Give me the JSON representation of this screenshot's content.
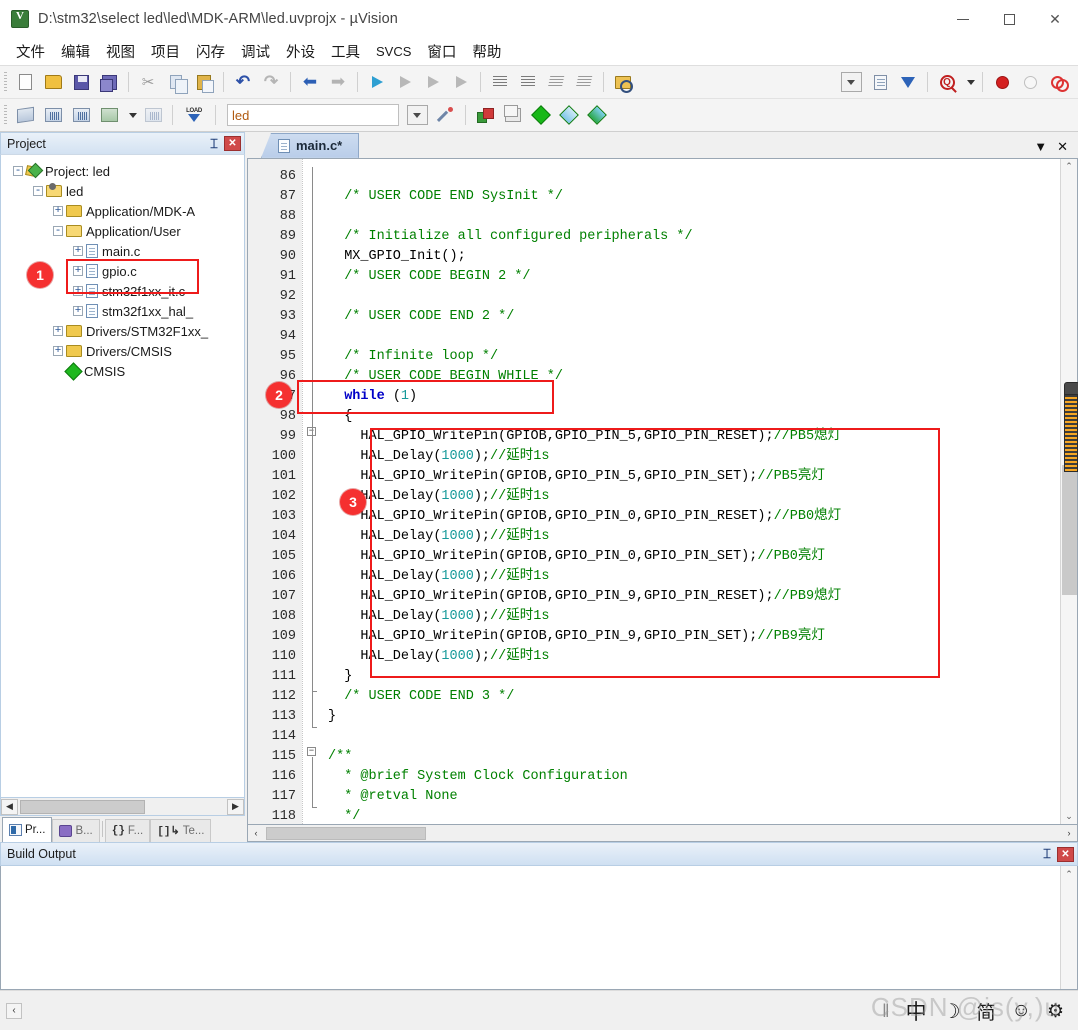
{
  "window": {
    "title": "D:\\stm32\\select led\\led\\MDK-ARM\\led.uvprojx - µVision",
    "app_icon": "uvision-icon",
    "minimize_label": "—",
    "maximize_label": "□",
    "close_label": "✕"
  },
  "menubar": {
    "items": [
      {
        "label": "文件",
        "name": "menu-file"
      },
      {
        "label": "编辑",
        "name": "menu-edit"
      },
      {
        "label": "视图",
        "name": "menu-view"
      },
      {
        "label": "项目",
        "name": "menu-project"
      },
      {
        "label": "闪存",
        "name": "menu-flash"
      },
      {
        "label": "调试",
        "name": "menu-debug"
      },
      {
        "label": "外设",
        "name": "menu-peripherals"
      },
      {
        "label": "工具",
        "name": "menu-tools"
      },
      {
        "label": "SVCS",
        "name": "menu-svcs"
      },
      {
        "label": "窗口",
        "name": "menu-window"
      },
      {
        "label": "帮助",
        "name": "menu-help"
      }
    ]
  },
  "toolbar_main": {
    "buttons": [
      "new-file-icon",
      "open-file-icon",
      "save-icon",
      "save-all-icon",
      "cut-icon",
      "copy-icon",
      "paste-icon",
      "undo-icon",
      "redo-icon",
      "navigate-back-icon",
      "navigate-forward-icon",
      "bookmark-toggle-icon",
      "bookmark-prev-icon",
      "bookmark-next-icon",
      "bookmark-clear-icon",
      "indent-icon",
      "outdent-icon",
      "comment-icon",
      "uncomment-icon",
      "open-folder-browse-icon",
      "dropdown-icon",
      "configuration-wizard-icon",
      "debug-start-icon",
      "find-in-files-icon",
      "find-caret-icon",
      "insert-breakpoint-icon",
      "disable-breakpoint-icon",
      "kill-all-breakpoints-icon"
    ]
  },
  "toolbar_build": {
    "target_value": "led",
    "buttons": [
      "translate-icon",
      "build-icon",
      "rebuild-icon",
      "batch-build-icon",
      "stop-build-icon",
      "download-load-icon",
      "target-dropdown-icon",
      "options-wizard-icon",
      "manage-project-items-icon",
      "multi-project-icon",
      "pack-installer-icon",
      "run-target-icon",
      "manage-runtime-env-icon"
    ]
  },
  "project_panel": {
    "caption": "Project",
    "pin_label": "⌶",
    "close_label": "✕",
    "tree": [
      {
        "label": "Project: led",
        "indent": 0,
        "expander": "-",
        "icon": "project-icon"
      },
      {
        "label": "led",
        "indent": 1,
        "expander": "-",
        "icon": "target-folder-icon"
      },
      {
        "label": "Application/MDK-A",
        "indent": 2,
        "expander": "+",
        "icon": "group-folder-icon"
      },
      {
        "label": "Application/User",
        "indent": 2,
        "expander": "-",
        "icon": "group-folder-icon"
      },
      {
        "label": "main.c",
        "indent": 3,
        "expander": "+",
        "icon": "c-file-icon"
      },
      {
        "label": "gpio.c",
        "indent": 3,
        "expander": "+",
        "icon": "c-file-icon"
      },
      {
        "label": "stm32f1xx_it.c",
        "indent": 3,
        "expander": "+",
        "icon": "c-file-icon"
      },
      {
        "label": "stm32f1xx_hal_",
        "indent": 3,
        "expander": "+",
        "icon": "c-file-icon"
      },
      {
        "label": "Drivers/STM32F1xx_",
        "indent": 2,
        "expander": "+",
        "icon": "group-folder-icon"
      },
      {
        "label": "Drivers/CMSIS",
        "indent": 2,
        "expander": "+",
        "icon": "group-folder-icon"
      },
      {
        "label": "CMSIS",
        "indent": 2,
        "expander": "",
        "icon": "cmsis-icon"
      }
    ],
    "hscroll_left": "◀",
    "hscroll_right": "▶",
    "tabs": [
      {
        "label": "Pr...",
        "icon": "project-tab-icon",
        "active": true
      },
      {
        "label": "B...",
        "icon": "books-tab-icon",
        "active": false
      },
      {
        "label": "F...",
        "icon": "functions-tab-icon",
        "active": false
      },
      {
        "label": "Te...",
        "icon": "templates-tab-icon",
        "active": false
      }
    ]
  },
  "editor": {
    "tab_label": "main.c*",
    "tab_icon": "c-file-icon",
    "tab_dropdown": "▼",
    "tab_close": "✕",
    "first_line": 86,
    "lines": [
      {
        "n": 86,
        "text": ""
      },
      {
        "n": 87,
        "text": "  /* USER CODE END SysInit */",
        "style": "c"
      },
      {
        "n": 88,
        "text": ""
      },
      {
        "n": 89,
        "text": "  /* Initialize all configured peripherals */",
        "style": "c"
      },
      {
        "n": 90,
        "text": "  MX_GPIO_Init();",
        "style": "plain"
      },
      {
        "n": 91,
        "text": "  /* USER CODE BEGIN 2 */",
        "style": "c"
      },
      {
        "n": 92,
        "text": ""
      },
      {
        "n": 93,
        "text": "  /* USER CODE END 2 */",
        "style": "c"
      },
      {
        "n": 94,
        "text": ""
      },
      {
        "n": 95,
        "text": "  /* Infinite loop */",
        "style": "c"
      },
      {
        "n": 96,
        "text": "  /* USER CODE BEGIN WHILE */",
        "style": "c"
      },
      {
        "n": 97,
        "text": "  while (1)",
        "style": "kw-while"
      },
      {
        "n": 98,
        "text": "  {",
        "style": "plain"
      },
      {
        "n": 99,
        "text": "    HAL_GPIO_WritePin(GPIOB,GPIO_PIN_5,GPIO_PIN_RESET);//PB5熄灯",
        "style": "hal"
      },
      {
        "n": 100,
        "text": "    HAL_Delay(1000);//延时1s",
        "style": "delay"
      },
      {
        "n": 101,
        "text": "    HAL_GPIO_WritePin(GPIOB,GPIO_PIN_5,GPIO_PIN_SET);//PB5亮灯",
        "style": "hal"
      },
      {
        "n": 102,
        "text": "    HAL_Delay(1000);//延时1s",
        "style": "delay"
      },
      {
        "n": 103,
        "text": "    HAL_GPIO_WritePin(GPIOB,GPIO_PIN_0,GPIO_PIN_RESET);//PB0熄灯",
        "style": "hal"
      },
      {
        "n": 104,
        "text": "    HAL_Delay(1000);//延时1s",
        "style": "delay"
      },
      {
        "n": 105,
        "text": "    HAL_GPIO_WritePin(GPIOB,GPIO_PIN_0,GPIO_PIN_SET);//PB0亮灯",
        "style": "hal"
      },
      {
        "n": 106,
        "text": "    HAL_Delay(1000);//延时1s",
        "style": "delay"
      },
      {
        "n": 107,
        "text": "    HAL_GPIO_WritePin(GPIOB,GPIO_PIN_9,GPIO_PIN_RESET);//PB9熄灯",
        "style": "hal"
      },
      {
        "n": 108,
        "text": "    HAL_Delay(1000);//延时1s",
        "style": "delay"
      },
      {
        "n": 109,
        "text": "    HAL_GPIO_WritePin(GPIOB,GPIO_PIN_9,GPIO_PIN_SET);//PB9亮灯",
        "style": "hal"
      },
      {
        "n": 110,
        "text": "    HAL_Delay(1000);//延时1s",
        "style": "delay"
      },
      {
        "n": 111,
        "text": "  }",
        "style": "plain"
      },
      {
        "n": 112,
        "text": "  /* USER CODE END 3 */",
        "style": "c"
      },
      {
        "n": 113,
        "text": "}",
        "style": "plain"
      },
      {
        "n": 114,
        "text": ""
      },
      {
        "n": 115,
        "text": "/**",
        "style": "c"
      },
      {
        "n": 116,
        "text": "  * @brief System Clock Configuration",
        "style": "c-brief"
      },
      {
        "n": 117,
        "text": "  * @retval None",
        "style": "c-brief"
      },
      {
        "n": 118,
        "text": "  */",
        "style": "c"
      }
    ],
    "scroll_up": "⌃",
    "scroll_down": "⌄",
    "hscroll_left": "‹",
    "hscroll_right": "›"
  },
  "build_output": {
    "caption": "Build Output",
    "pin_label": "⌶",
    "close_label": "✕",
    "content": ""
  },
  "annotations": [
    {
      "number": "1",
      "target": "main-c-tree-item"
    },
    {
      "number": "2",
      "target": "while-loop-line"
    },
    {
      "number": "3",
      "target": "led-blink-code-block"
    }
  ],
  "ime_bar": {
    "separator": "‖",
    "mode_label": "中",
    "moon_icon": "moon-icon",
    "simplified_label": "简",
    "smiley_icon": "smiley-icon",
    "gear_icon": "gear-icon"
  },
  "watermark": {
    "text": "CSDN @is(y,)u"
  },
  "colors": {
    "annotation_red": "#ee1b1b",
    "badge_red": "#f53030",
    "comment_green": "#008000",
    "keyword_blue": "#0000c8",
    "number_teal": "#179a9a",
    "caption_blue": "#cfe0f2"
  }
}
